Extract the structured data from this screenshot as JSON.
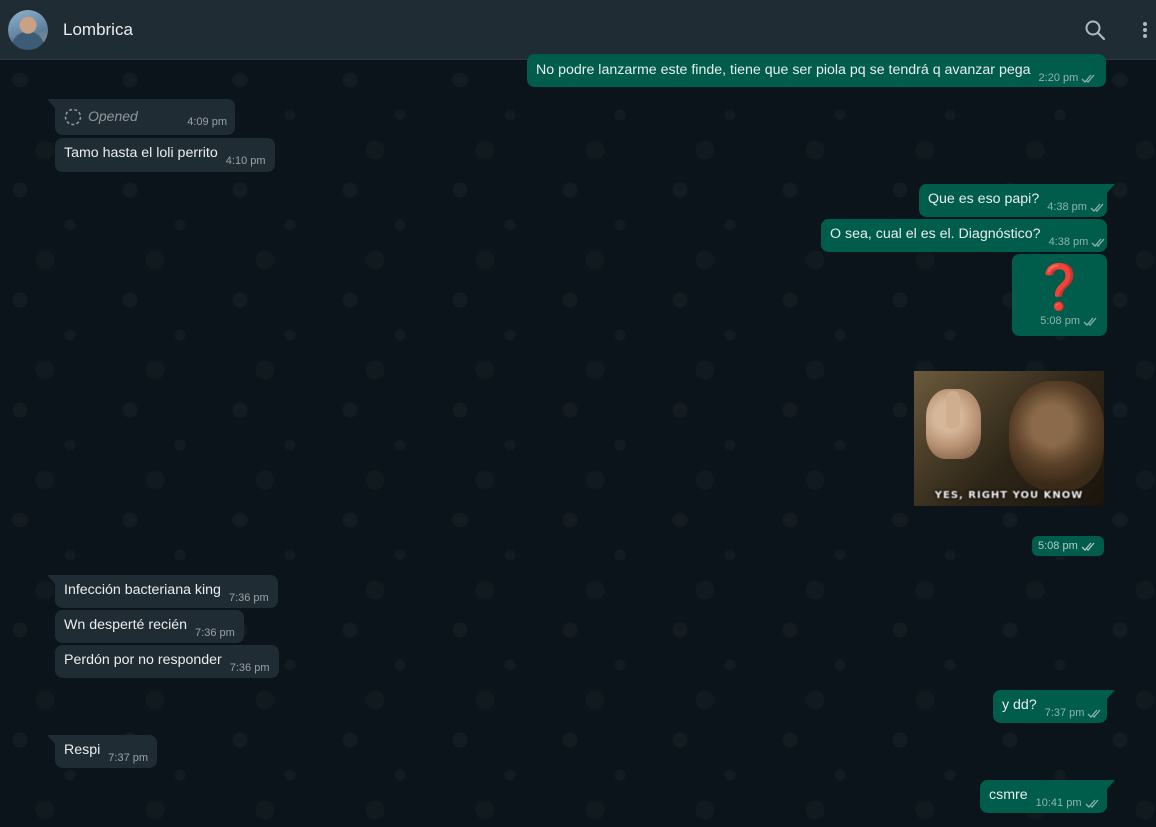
{
  "header": {
    "contact_name": "Lombrica",
    "search_icon": "search-icon",
    "menu_icon": "more-vertical-icon"
  },
  "colors": {
    "header_bg": "#202c33",
    "chat_bg": "#0b141a",
    "incoming_bubble": "#202c33",
    "outgoing_bubble": "#005c4b",
    "read_ticks": "#53bdeb"
  },
  "messages": [
    {
      "direction": "out",
      "text": "No podre lanzarme este finde, tiene que ser piola pq se tendrá q avanzar pega",
      "time": "2:20 pm",
      "status": "delivered"
    },
    {
      "direction": "in",
      "type": "view-once",
      "text": "Opened",
      "time": "4:09 pm"
    },
    {
      "direction": "in",
      "text": "Tamo hasta el loli perrito",
      "time": "4:10 pm"
    },
    {
      "direction": "out",
      "text": "Que es eso papi?",
      "time": "4:38 pm",
      "status": "delivered"
    },
    {
      "direction": "out",
      "text": "O sea, cual el es el. Diagnóstico?",
      "time": "4:38 pm",
      "status": "delivered"
    },
    {
      "direction": "out",
      "type": "emoji",
      "text": "❓",
      "time": "5:08 pm",
      "status": "delivered"
    },
    {
      "direction": "out",
      "type": "sticker",
      "caption": "YES, RIGHT YOU KNOW",
      "time": "5:08 pm",
      "status": "delivered"
    },
    {
      "direction": "in",
      "text": "Infección bacteriana king",
      "time": "7:36 pm"
    },
    {
      "direction": "in",
      "text": "Wn desperté recién",
      "time": "7:36 pm"
    },
    {
      "direction": "in",
      "text": "Perdón por no responder",
      "time": "7:36 pm"
    },
    {
      "direction": "out",
      "text": "y dd?",
      "time": "7:37 pm",
      "status": "delivered"
    },
    {
      "direction": "in",
      "text": "Respi",
      "time": "7:37 pm"
    },
    {
      "direction": "out",
      "text": "csmre",
      "time": "10:41 pm",
      "status": "delivered"
    }
  ]
}
